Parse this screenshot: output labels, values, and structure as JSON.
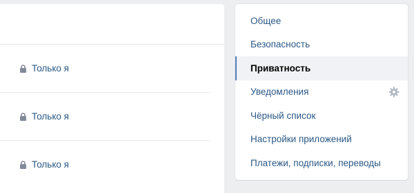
{
  "privacy_rows": [
    {
      "value": "Только я",
      "icon": "lock-icon"
    },
    {
      "value": "Только я",
      "icon": "lock-icon"
    },
    {
      "value": "Только я",
      "icon": "lock-icon"
    }
  ],
  "settings_menu": {
    "items": [
      {
        "label": "Общее"
      },
      {
        "label": "Безопасность"
      },
      {
        "label": "Приватность",
        "active": true
      },
      {
        "label": "Уведомления",
        "icon": "gear-icon"
      },
      {
        "label": "Чёрный список"
      },
      {
        "label": "Настройки приложений"
      },
      {
        "label": "Платежи, подписки, переводы"
      }
    ]
  },
  "colors": {
    "link": "#2a5885",
    "active_border": "#5181b8",
    "active_bg": "#f0f2f5",
    "page_bg": "#edeef0",
    "icon_gray": "#aeb7c2"
  }
}
